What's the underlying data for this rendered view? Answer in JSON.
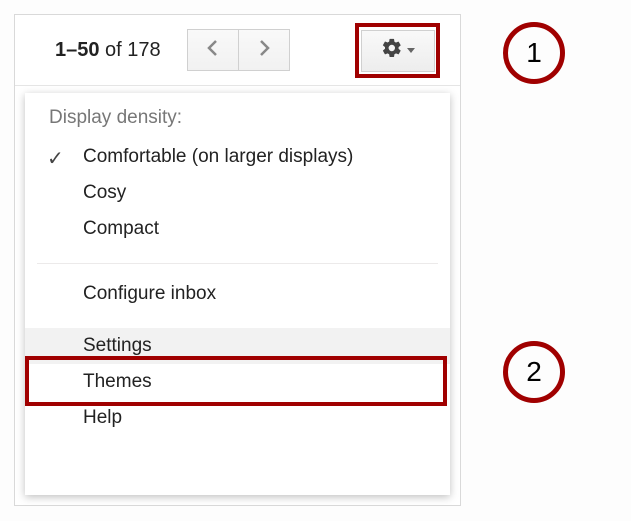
{
  "toolbar": {
    "range_start": "1",
    "range_end": "50",
    "range_sep_word": " of ",
    "range_total": "178"
  },
  "menu": {
    "header": "Display density:",
    "density": [
      {
        "label": "Comfortable (on larger displays)",
        "checked": true
      },
      {
        "label": "Cosy",
        "checked": false
      },
      {
        "label": "Compact",
        "checked": false
      }
    ],
    "items": [
      {
        "label": "Configure inbox",
        "highlighted": false
      },
      {
        "label": "Settings",
        "highlighted": true
      },
      {
        "label": "Themes",
        "highlighted": false
      },
      {
        "label": "Help",
        "highlighted": false
      }
    ]
  },
  "callouts": {
    "one": "1",
    "two": "2"
  }
}
